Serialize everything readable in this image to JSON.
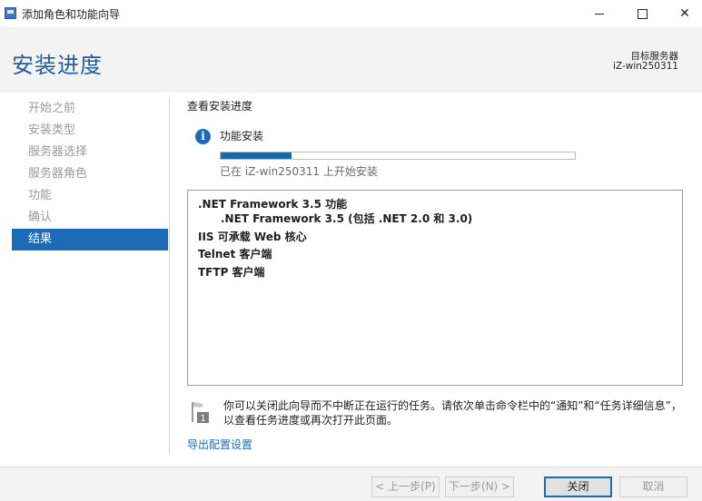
{
  "window": {
    "title": "添加角色和功能向导",
    "controls": {
      "close_glyph": "✕"
    }
  },
  "header": {
    "page_title": "安装进度",
    "target_server_label": "目标服务器",
    "target_server_name": "iZ-win250311"
  },
  "nav": {
    "items": [
      {
        "label": "开始之前",
        "active": false
      },
      {
        "label": "安装类型",
        "active": false
      },
      {
        "label": "服务器选择",
        "active": false
      },
      {
        "label": "服务器角色",
        "active": false
      },
      {
        "label": "功能",
        "active": false
      },
      {
        "label": "确认",
        "active": false
      },
      {
        "label": "结果",
        "active": true
      }
    ]
  },
  "main": {
    "section_label": "查看安装进度",
    "info_glyph": "i",
    "feature_install_label": "功能安装",
    "progress_fraction": 0.2,
    "progress_status": "已在 iZ-win250311 上开始安装",
    "results": [
      ".NET Framework 3.5 功能",
      ".NET Framework 3.5 (包括 .NET 2.0 和 3.0)",
      "IIS 可承载 Web 核心",
      "Telnet 客户端",
      "TFTP 客户端"
    ],
    "notice_text": "你可以关闭此向导而不中断正在运行的任务。请依次单击命令栏中的“通知”和“任务详细信息”，以查看任务进度或再次打开此页面。",
    "notice_icon_number": "1",
    "export_link": "导出配置设置"
  },
  "footer": {
    "prev_label": "< 上一步(P)",
    "next_label": "下一步(N) >",
    "close_label": "关闭",
    "cancel_label": "取消"
  },
  "colors": {
    "accent": "#1c6bb6",
    "title": "#1f5fa0",
    "progress": "#1b6aa5"
  }
}
